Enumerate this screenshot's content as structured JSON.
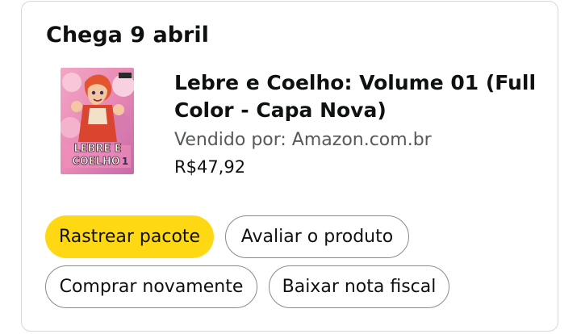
{
  "delivery": {
    "heading": "Chega 9 abril"
  },
  "product": {
    "title": "Lebre e Coelho: Volume 01 (Full Color - Capa Nova)",
    "seller": "Vendido por: Amazon.com.br",
    "price": "R$47,92",
    "cover_logo_text_line1": "LEBRE E",
    "cover_logo_text_line2": "COELHO",
    "cover_volume": "1"
  },
  "actions": {
    "track_package": "Rastrear pacote",
    "review_product": "Avaliar o produto",
    "buy_again": "Comprar novamente",
    "download_invoice": "Baixar nota fiscal"
  },
  "colors": {
    "primary_button": "#ffd814",
    "border": "#d5d9d9",
    "button_border": "#888c8c",
    "secondary_text": "#565959"
  }
}
